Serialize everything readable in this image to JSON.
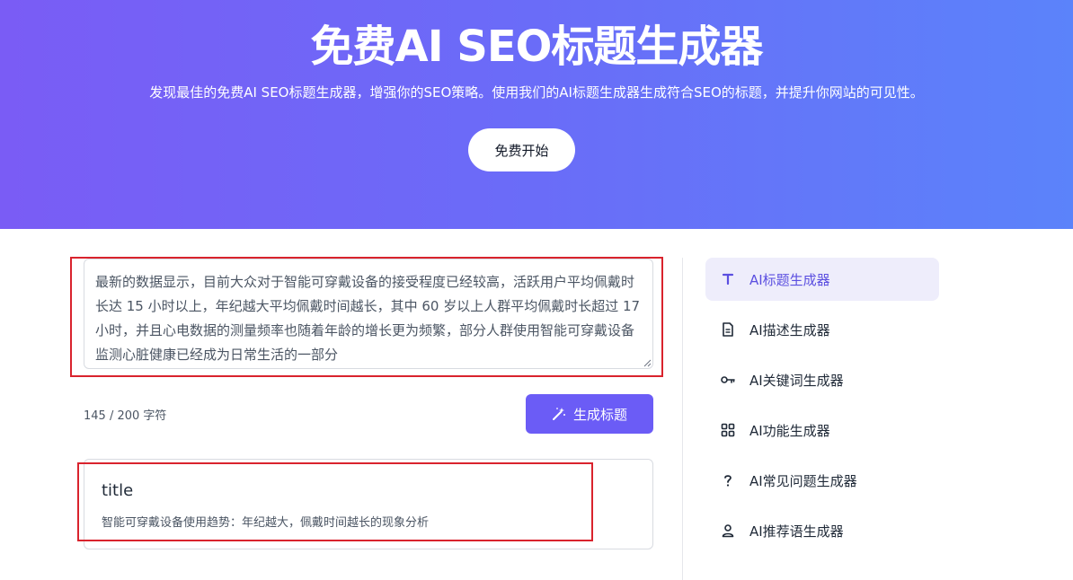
{
  "hero": {
    "title": "免费AI SEO标题生成器",
    "subtitle": "发现最佳的免费AI SEO标题生成器，增强你的SEO策略。使用我们的AI标题生成器生成符合SEO的标题，并提升你网站的可见性。",
    "cta_label": "免费开始"
  },
  "editor": {
    "input_value": "最新的数据显示，目前大众对于智能可穿戴设备的接受程度已经较高，活跃用户平均佩戴时长达 15 小时以上，年纪越大平均佩戴时间越长，其中 60 岁以上人群平均佩戴时长超过 17 小时，并且心电数据的测量频率也随着年龄的增长更为频繁，部分人群使用智能可穿戴设备监测心脏健康已经成为日常生活的一部分",
    "char_count": "145 / 200 字符",
    "generate_label": "生成标题"
  },
  "result": {
    "title": "title",
    "text": "智能可穿戴设备使用趋势：年纪越大，佩戴时间越长的现象分析"
  },
  "sidebar": {
    "items": [
      {
        "label": "AI标题生成器",
        "icon": "text-icon",
        "active": true
      },
      {
        "label": "AI描述生成器",
        "icon": "document-icon",
        "active": false
      },
      {
        "label": "AI关键词生成器",
        "icon": "key-icon",
        "active": false
      },
      {
        "label": "AI功能生成器",
        "icon": "grid-icon",
        "active": false
      },
      {
        "label": "AI常见问题生成器",
        "icon": "question-icon",
        "active": false
      },
      {
        "label": "AI推荐语生成器",
        "icon": "user-icon",
        "active": false
      }
    ]
  },
  "colors": {
    "accent": "#6b5cf6",
    "active_bg": "#eeedfb",
    "annotation_red": "#d9232d"
  }
}
